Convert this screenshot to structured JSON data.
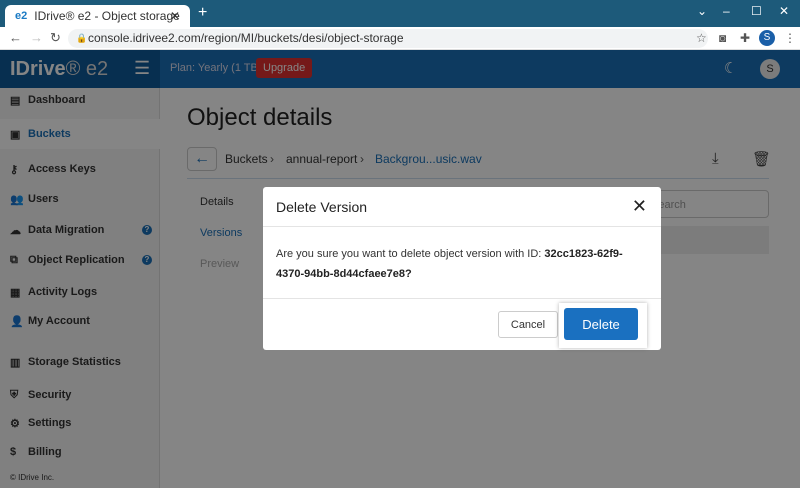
{
  "browser": {
    "tab_title": "IDrive® e2 - Object storage",
    "tab_favicon": "e2",
    "url": "console.idrivee2.com/region/MI/buckets/desi/object-storage",
    "profile": "S"
  },
  "header": {
    "logo": "IDrive",
    "logo_suffix": "® e2",
    "plan": "Plan: Yearly (1 TB)",
    "upgrade": "Upgrade",
    "user_initial": "S"
  },
  "sidebar": {
    "items": [
      {
        "label": "Dashboard",
        "icon": "▤"
      },
      {
        "label": "Buckets",
        "icon": "▣"
      },
      {
        "label": "Access Keys",
        "icon": "⚷"
      },
      {
        "label": "Users",
        "icon": "👥"
      },
      {
        "label": "Data Migration",
        "icon": "☁"
      },
      {
        "label": "Object Replication",
        "icon": "⧉"
      },
      {
        "label": "Activity Logs",
        "icon": "▦"
      },
      {
        "label": "My Account",
        "icon": "👤"
      },
      {
        "label": "Storage Statistics",
        "icon": "▥"
      },
      {
        "label": "Security",
        "icon": "⛨"
      },
      {
        "label": "Settings",
        "icon": "⚙"
      },
      {
        "label": "Billing",
        "icon": "$"
      }
    ],
    "help": "?",
    "footer": "© IDrive Inc."
  },
  "main": {
    "title": "Object details",
    "breadcrumb": [
      "Buckets",
      "annual-report",
      "Backgrou...usic.wav"
    ],
    "tabs": [
      "Details",
      "Versions",
      "Preview"
    ],
    "search_placeholder": "Search"
  },
  "modal": {
    "title": "Delete Version",
    "message": "Are you sure you want to delete object version with ID: ",
    "version_id": "32cc1823-62f9-4370-94bb-8d44cfaee7e8?",
    "cancel": "Cancel",
    "delete": "Delete"
  }
}
